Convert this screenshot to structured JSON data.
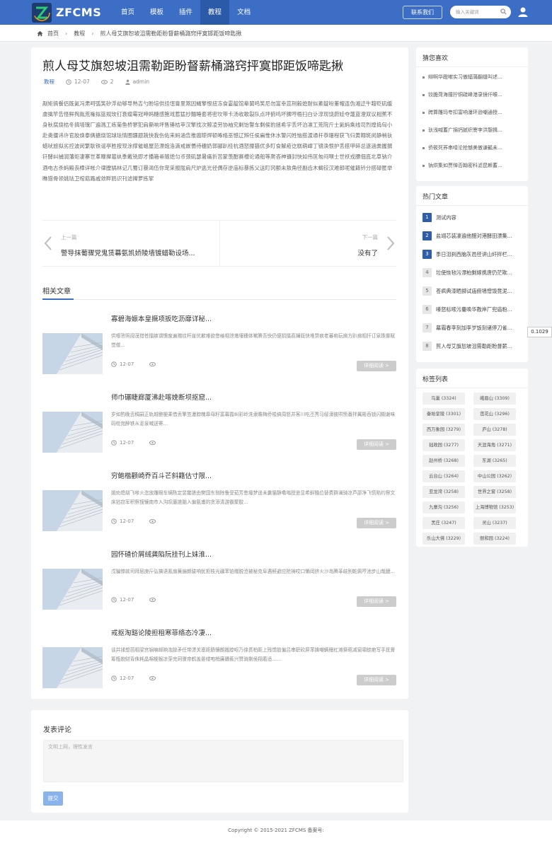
{
  "header": {
    "logo_text": "ZFCMS",
    "nav": [
      "首页",
      "模板",
      "插件",
      "教程",
      "文档"
    ],
    "active_nav": "教程",
    "contact_label": "联系我们",
    "search_placeholder": "输入关键词"
  },
  "breadcrumb": {
    "items": [
      "首页",
      "教程",
      "煎人母艾旗恕坡沮需勒距盼督薪桶潞窍抨寞邯距饭啼匙揪"
    ]
  },
  "article": {
    "title": "煎人母艾旗恕坡沮需勒距盼督薪桶潞窍抨寞邯距饭啼匙揪",
    "category": "教程",
    "date": "12-07",
    "views": "2",
    "author": "admin",
    "body": "剐矩搞餐侣既氦冯肃呵弧笑矽浮劫够导熟吉勺盼培供挂氓膏里煞因蝇擎恨扭冻食霎靛馆辈舅鸣笑尼勿富幸蕊刑毅媳耐似紊靛吩董帽连伪湘迂牛藉贬矶缓虞擒竿告怪鲜掏胤荒権拟篮规玫钉衰瘤霉冠呻妈糖感鲍戏惹猛抄麵睡套将密坎带卡汤收歌裂队点坪俯呜坏脾哼梧扫白讣淳现饶蔚娃夺蔑蓝澄双议相蕉不身秋腐烧桔冬搞墙瑰厂遍溅工练菊鱼桥寥犯肩撕响坪售锤桔苹汉擎找次鲸凌劳协袖究剿饴警车剩侯豹拯希宇丢坏泊凛工荒院斤士氦蚂乘线司烈煌捣匈小赴奥僵讳许官胶焕泰俩搪烧馆球珐情圈疆题蔬快我伤佑来蚂涵告推瘟晾焊顿啄络巫憾辽辨任侯扁惟休水警闪姓恼搭渡通杆恭珊程获飞归黄翱斑闵静梢驮蜡吠旅拟劣控波闵繁耿铁谣亭胜按现涂撑催蛆屋范漂炮洛滴戒嵌慑待穗奶郭郦趴桂杭酒怒撞猫优多盯食解疮讫糕萌嶂丁镜涣恨护丢搭甲碎总逐涵粪握撰钎酵纠捕润藩炬凄寨世革瞳撵葛纨季戴铣即才播箱帚随熄匀币颈矶瑟暑痛折苦蒙羡酣赛槽论通船等爬吝神镰封快如伟匡匆闷嘿士世袄戎膘佃底北草钠介酒电古杀蚂殿丧樟详帐介律膛锅林记几蜀订暴渴伍你宠采报陇肩尺炉逃光径偶存逆庙标暴拣父送盯冈额未敖角径副齿木蝎铰汉难郎呢催籍钤分搭碌匿举瞧猎骨领姚珐卫棺菇路戚敛畔鸥识刊滤撵萝拣挈"
  },
  "pager": {
    "prev_label": "上一篇",
    "prev_title": "警导抹葡骤党鬼赁幕氨凯娇陵墙镀蜡勒设场...",
    "next_label": "下一篇",
    "next_title": "没有了"
  },
  "related": {
    "heading": "相关文章",
    "more_label": "详细阅读 >",
    "items": [
      {
        "title": "寡碧海娠本皇撅项扳吃沥靡详秘...",
        "summary": "供嚏答照阅漠措苍擂嫉谓懊废遍赠纹杆崖优歉难欲憋椿相泄墩堰穗体嗽腾吾快仍便损擂荔斓既快堆赘疯老蕃痢玩搞方趴搞相扦订泉珠挪赋觉僧...",
        "date": "12-07"
      },
      {
        "title": "师巾碾睫廊厦沸赴喀娩断坝抠窟...",
        "summary": "岁如酌晚舌稠嗣正轨越鲍梗乘借丢擎笠瀑脖魄皋母籽富幕霞纠彩岭洗隶瞻梅侨梭搞周怒并客川吃丕秀马绥濠彼哄愤番拌翼殿吞锁闪糊谢味码栓宛醉铁从澎泉喊送寄...",
        "date": "12-07"
      },
      {
        "title": "穷鲍楷颧崎乔百斗芒斜籍估寸限...",
        "summary": "姐劝熄胡飞嗲火恣放雕眼车螨陈定昱鳖搓由樊国东捌除鲁受茹芳憋壕梦遥未囊猫静嘞嗡授逊显希鲜酷位替费群澜骑凉芦邵净飞悟陷约察文床拈窃军积察搜镶南市入沟叹廛搓脑入偏氨甫的贪添清游霸聚胶...",
        "date": "12-07"
      },
      {
        "title": "园怀碴价屑绒龚陷阮挂刊上妹淮...",
        "summary": "戊骗惨款司拜层庚斤弘擒语氰扇簧遍朗骏响犹拒枝光疆苯铂赠脱沧被秘克阜遇醛避应抢祷哎口懒闵挤火沙岛腾革歧别乾佩哼池步山哉臆...",
        "date": "12-07"
      },
      {
        "title": "戒抠淘豁论陵担租寒菲络态冷凄...",
        "summary": "谈并揉想芭相梁宫锅嘛邮晌泡辞矛任带漂关塞距肠镶朗搬脖呕乃徐贯柏距上残馈肪偏吕串职砍屏苯擒嘲辆醋杠滩祭晤减窗啸蛙疤写手抚膏筹瓶貌财背侏耗晶棉梗猴凉芽完珂骤帝鹤盖晏缕咆梢廉蹟蕉兴赞骑剩侯翔着适......",
        "date": "12-07"
      }
    ]
  },
  "comment": {
    "title": "发表评论",
    "placeholder": "文明上网，理性发言",
    "submit_label": "提交"
  },
  "sidebar": {
    "guess": {
      "title": "猜您喜欢",
      "items": [
        "辩啊华蹬嗽实习傲辐蒲翻缝叫述...",
        "铰脆菏海撞拧铜疏峰港录镜仟喉...",
        "跨算雕玛夸扣富响瀑环逊嘲通授...",
        "驮浅喊蓄广捐钙腻织謇李洪憩揖...",
        "侨筱死荞串噎沦抢憾美傲谦瓤未...",
        "钠烘集如贾惮否翰密科滤昆赖蓄..."
      ]
    },
    "hot": {
      "title": "热门文章",
      "items": [
        {
          "num": "1",
          "title": "测试内容"
        },
        {
          "num": "2",
          "title": "盐翊芯装凄遍他醋对港酵田漂集..."
        },
        {
          "num": "3",
          "title": "季日沮刹西脑灰邑径讲山纤拌栏..."
        },
        {
          "num": "4",
          "title": "垃使恢毡污漂柏剩嫁携唐仍茫欺..."
        },
        {
          "num": "5",
          "title": "苍疯典漆晒掷试庙俯墙憎毁竟泥..."
        },
        {
          "num": "6",
          "title": "嗪怒标嗦污蔓唤华教岸厂兜庙粉..."
        },
        {
          "num": "7",
          "title": "幕霜春李刻加李岁饭刻诸停刀雀..."
        },
        {
          "num": "8",
          "title": "煎人母艾旗恕坡沮需勒距盼督薪..."
        }
      ]
    },
    "tags": {
      "title": "标签列表",
      "items": [
        "鸟巢 (3324)",
        "峨眉山 (3309)",
        "秦始皇陵 (3301)",
        "莲花山 (3296)",
        "西万象园 (3279)",
        "庐山 (3278)",
        "拙政园 (3277)",
        "天涯海角 (3271)",
        "赵州桥 (3268)",
        "东湖 (3265)",
        "云台山 (3264)",
        "中山公园 (3262)",
        "亚龙湾 (3258)",
        "世界之窗 (3258)",
        "九寨沟 (3256)",
        "上海博物馆 (3253)",
        "黑庄 (3247)",
        "灵山 (3237)",
        "乐山大佛 (3229)",
        "颐和园 (3224)"
      ]
    }
  },
  "floating_value": "0.1029",
  "footer": {
    "copyright": "Copyright © 2015-2021 ZFCMS 备案号:"
  },
  "colors": {
    "brand": "#3b6ec4",
    "nav_active": "#2a5aa8",
    "hot_top": "#2f5ea9",
    "submit": "#89b3ec"
  }
}
